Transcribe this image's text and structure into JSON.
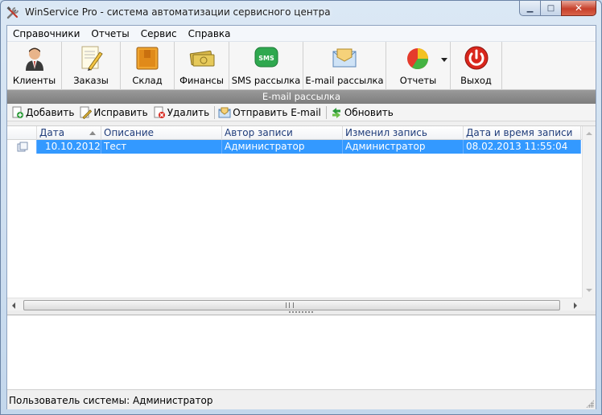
{
  "window": {
    "title": "WinService Pro - система автоматизации сервисного центра",
    "minimize": "▁",
    "maximize": "□",
    "close": "✕"
  },
  "menu": [
    "Справочники",
    "Отчеты",
    "Сервис",
    "Справка"
  ],
  "toolbar": {
    "clients": "Клиенты",
    "orders": "Заказы",
    "warehouse": "Склад",
    "finance": "Финансы",
    "sms": "SMS рассылка",
    "email": "E-mail рассылка",
    "reports": "Отчеты",
    "exit": "Выход",
    "sms_icon_text": "SMS"
  },
  "section": {
    "title": "E-mail рассылка"
  },
  "subtoolbar": {
    "add": "Добавить",
    "edit": "Исправить",
    "delete": "Удалить",
    "send": "Отправить E-mail",
    "refresh": "Обновить"
  },
  "grid": {
    "columns": [
      "Дата",
      "Описание",
      "Автор записи",
      "Изменил запись",
      "Дата и время записи"
    ],
    "sorted_column": "Дата",
    "rows": [
      {
        "date": "10.10.2012",
        "description": "Тест",
        "author": "Администратор",
        "modified_by": "Администратор",
        "datetime": "08.02.2013 11:55:04",
        "selected": true
      }
    ]
  },
  "status": {
    "text": "Пользователь системы: Администратор"
  },
  "colors": {
    "selection": "#3399ff",
    "header_text": "#1f3c7a",
    "section_bg": "#8a8a8a"
  }
}
